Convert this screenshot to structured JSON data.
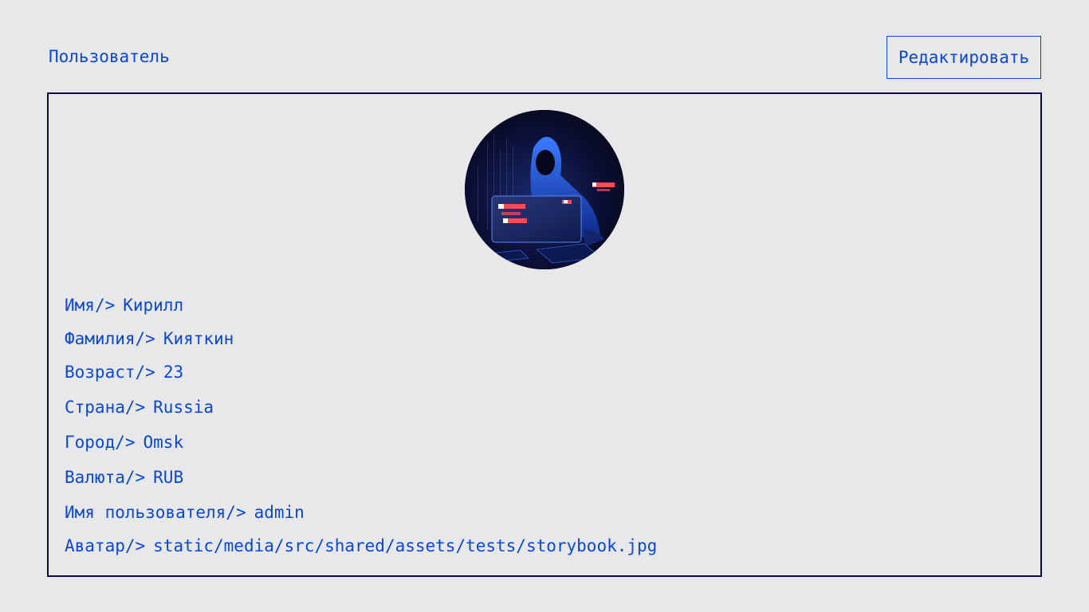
{
  "header": {
    "title": "Пользователь",
    "edit_label": "Редактировать"
  },
  "profile": {
    "avatar_icon": "hooded-hacker-avatar",
    "separator": "/>",
    "fields": [
      {
        "label": "Имя",
        "value": "Кирилл"
      },
      {
        "label": "Фамилия",
        "value": "Кияткин"
      },
      {
        "label": "Возраст",
        "value": "23"
      },
      {
        "label": "Страна",
        "value": "Russia"
      },
      {
        "label": "Город",
        "value": "Omsk"
      },
      {
        "label": "Валюта",
        "value": "RUB"
      },
      {
        "label": "Имя пользователя",
        "value": "admin"
      },
      {
        "label": "Аватар",
        "value": "static/media/src/shared/assets/tests/storybook.jpg"
      }
    ]
  },
  "colors": {
    "background": "#e8e8eb",
    "accent": "#0a47d6",
    "card_border": "#0c0b4a"
  }
}
